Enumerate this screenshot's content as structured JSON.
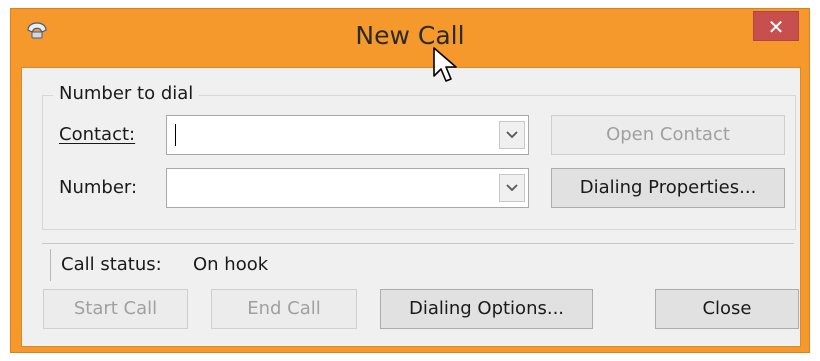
{
  "window": {
    "title": "New Call",
    "close_symbol": "✕",
    "accent_color": "#f5992d"
  },
  "group": {
    "legend": "Number to dial"
  },
  "contact": {
    "label": "Contact:",
    "value": ""
  },
  "number": {
    "label": "Number:",
    "value": ""
  },
  "buttons": {
    "open_contact": "Open Contact",
    "dialing_properties": "Dialing Properties...",
    "start_call": "Start Call",
    "end_call": "End Call",
    "dialing_options": "Dialing Options...",
    "close": "Close"
  },
  "status": {
    "label": "Call status:",
    "value": "On hook"
  },
  "icons": {
    "app": "phone-icon",
    "dropdown": "chevron-down-icon",
    "cursor": "mouse-pointer-icon"
  }
}
